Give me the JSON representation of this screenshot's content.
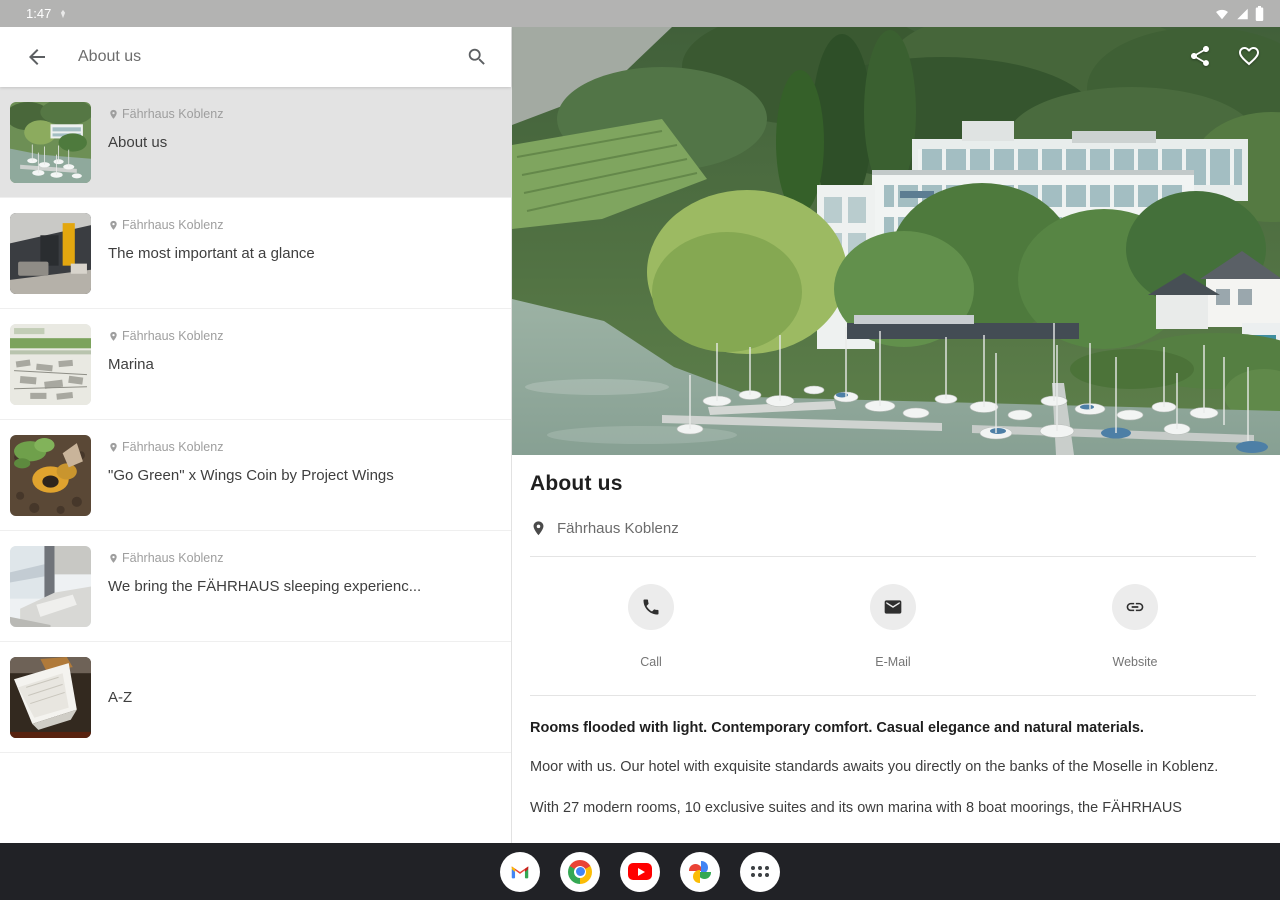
{
  "status_bar": {
    "time": "1:47",
    "icons": [
      "status-notification-icon",
      "wifi-icon",
      "signal-icon",
      "battery-icon"
    ]
  },
  "app_bar": {
    "title": "About us",
    "icons": [
      "back-arrow-icon",
      "search-icon"
    ]
  },
  "list": {
    "items": [
      {
        "subtitle": "Fährhaus Koblenz",
        "title": "About us",
        "selected": true,
        "thumbnail": "marina-aerial-photo"
      },
      {
        "subtitle": "Fährhaus Koblenz",
        "title": "The most important at a glance",
        "selected": false,
        "thumbnail": "hotel-interior-photo"
      },
      {
        "subtitle": "Fährhaus Koblenz",
        "title": "Marina",
        "selected": false,
        "thumbnail": "marina-plan-photo"
      },
      {
        "subtitle": "Fährhaus Koblenz",
        "title": "\"Go Green\" x Wings Coin by Project Wings",
        "selected": false,
        "thumbnail": "planting-hands-photo"
      },
      {
        "subtitle": "Fährhaus Koblenz",
        "title": "We bring the FÄHRHAUS sleeping experienc...",
        "selected": false,
        "thumbnail": "bedroom-photo"
      },
      {
        "subtitle": "",
        "title": "A-Z",
        "selected": false,
        "thumbnail": "open-book-photo"
      }
    ]
  },
  "detail": {
    "title": "About us",
    "location": "Fährhaus Koblenz",
    "hero_icons": [
      "share-icon",
      "heart-icon"
    ],
    "actions": [
      {
        "label": "Call",
        "icon": "phone-icon"
      },
      {
        "label": "E-Mail",
        "icon": "email-icon"
      },
      {
        "label": "Website",
        "icon": "link-icon"
      }
    ],
    "lead": "Rooms flooded with light. Contemporary comfort. Casual elegance and natural materials.",
    "body": "Moor with us. Our hotel with exquisite standards awaits you directly on the banks of the Moselle in Koblenz.",
    "body2": "With 27 modern rooms, 10 exclusive suites and its own marina with 8 boat moorings, the FÄHRHAUS"
  },
  "taskbar": {
    "apps": [
      "gmail-icon",
      "chrome-icon",
      "youtube-icon",
      "google-photos-icon",
      "app-drawer-icon"
    ]
  },
  "colors": {
    "status_bar_bg": "#b3b3b2",
    "selected_item_bg": "#e3e3e3",
    "taskbar_bg": "#212226",
    "action_circle_bg": "#ececec",
    "divider": "#e4e4e4",
    "text_primary": "#1f1f1f",
    "text_secondary": "#9e9e9e",
    "youtube_red": "#ff0000",
    "google_blue": "#4285f4",
    "google_red": "#ea4335",
    "google_yellow": "#fbbc05",
    "google_green": "#34a853"
  }
}
